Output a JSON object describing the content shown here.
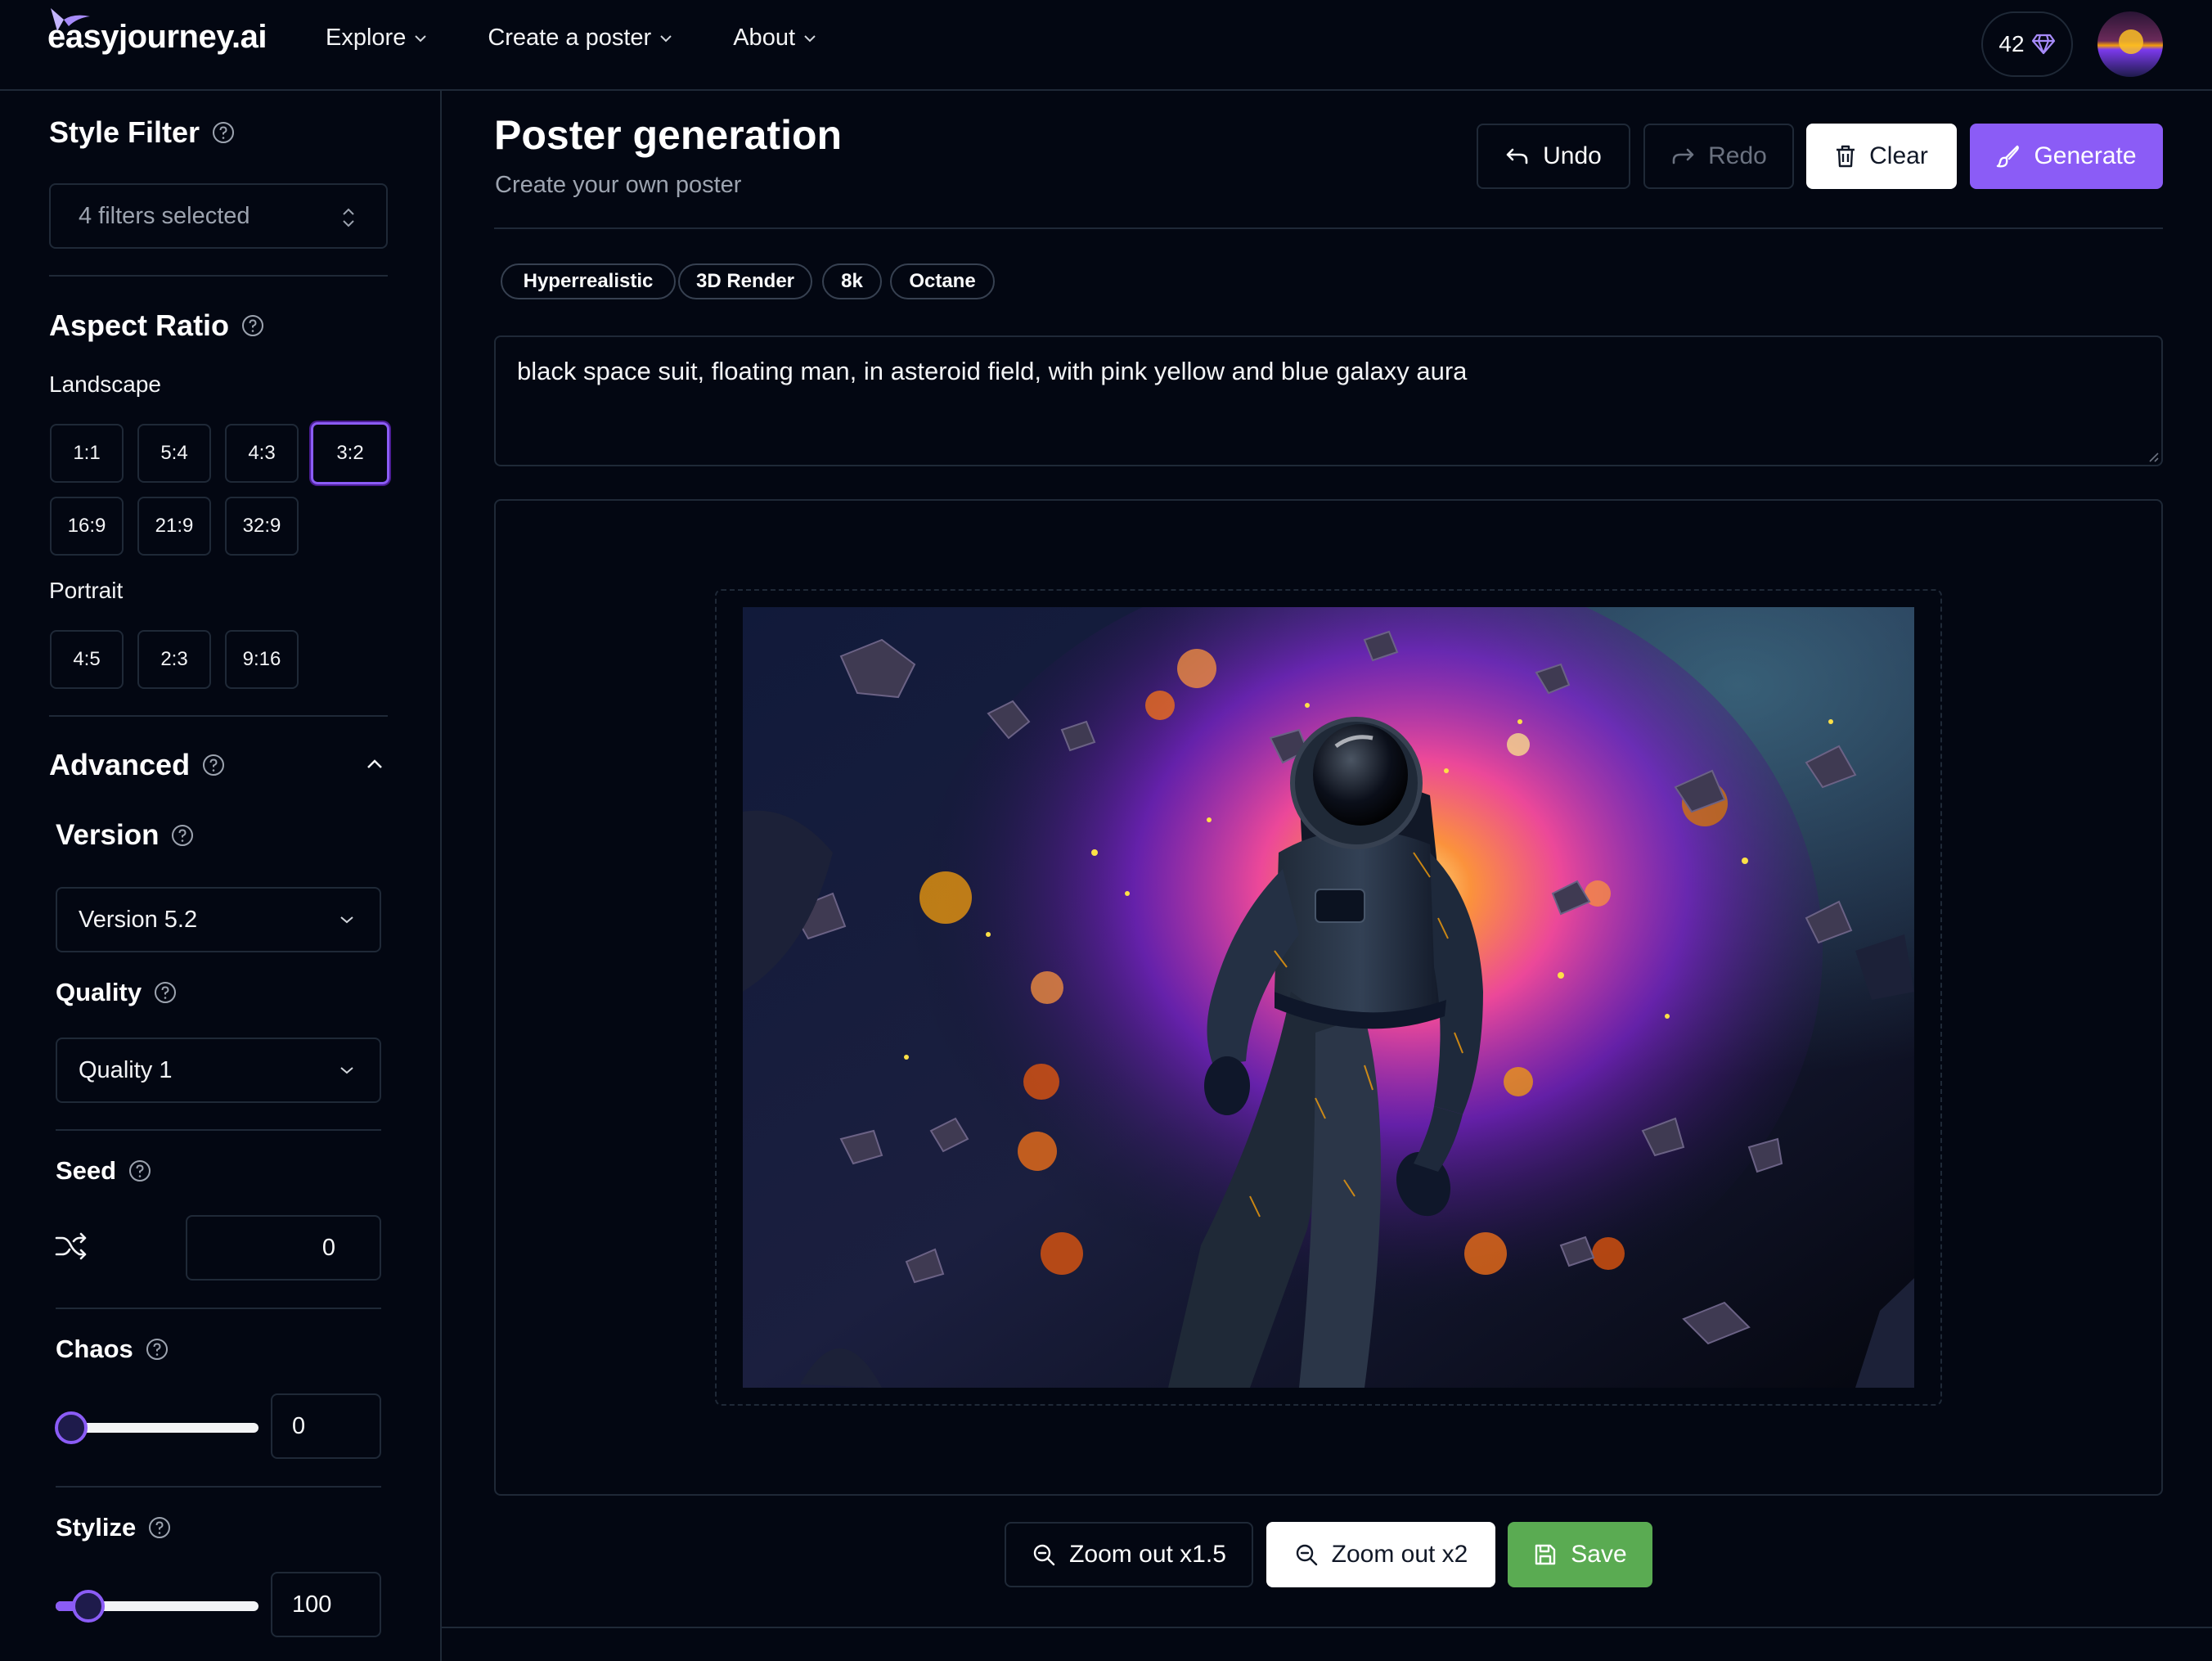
{
  "nav": {
    "brand": "easyjourney.ai",
    "links": [
      "Explore",
      "Create a poster",
      "About"
    ],
    "credits": "42"
  },
  "sidebar": {
    "style_filter": {
      "title": "Style Filter",
      "value": "4 filters selected"
    },
    "aspect_ratio": {
      "title": "Aspect Ratio",
      "landscape_label": "Landscape",
      "landscape": [
        "1:1",
        "5:4",
        "4:3",
        "3:2",
        "16:9",
        "21:9",
        "32:9"
      ],
      "portrait_label": "Portrait",
      "portrait": [
        "4:5",
        "2:3",
        "9:16"
      ],
      "selected": "3:2"
    },
    "advanced": {
      "title": "Advanced",
      "version": {
        "title": "Version",
        "value": "Version 5.2"
      },
      "quality": {
        "title": "Quality",
        "value": "Quality 1"
      },
      "seed": {
        "title": "Seed",
        "value": "0"
      },
      "chaos": {
        "title": "Chaos",
        "value": "0",
        "level": 0
      },
      "stylize": {
        "title": "Stylize",
        "value": "100",
        "level": 0.1
      }
    }
  },
  "main": {
    "title": "Poster generation",
    "subtitle": "Create your own poster",
    "toolbar": {
      "undo": "Undo",
      "redo": "Redo",
      "clear": "Clear",
      "generate": "Generate"
    },
    "tags": [
      "Hyperrealistic",
      "3D Render",
      "8k",
      "Octane"
    ],
    "prompt": "black space suit, floating man, in asteroid field, with pink yellow and blue galaxy aura",
    "actions": {
      "zoom15": "Zoom out x1.5",
      "zoom2": "Zoom out x2",
      "save": "Save"
    }
  },
  "colors": {
    "accent": "#8b5cf6",
    "save": "#5aab52",
    "background": "#030712",
    "border": "#1f2937"
  }
}
